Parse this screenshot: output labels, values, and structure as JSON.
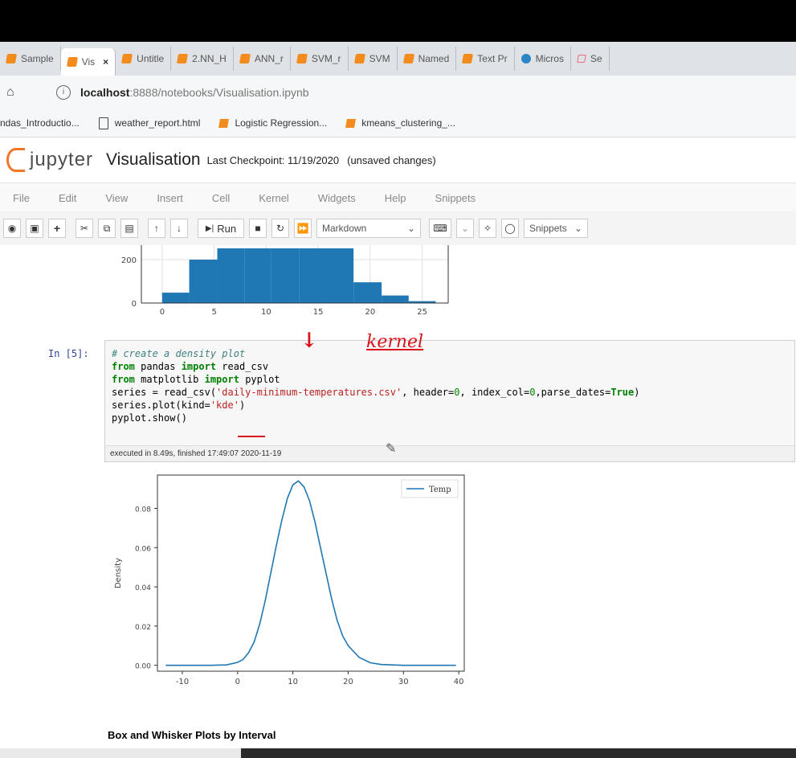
{
  "browser": {
    "tabs": [
      {
        "label": "Sample",
        "icon": "jupyter-favicon-icon"
      },
      {
        "label": "Vis",
        "icon": "jupyter-favicon-icon",
        "active": true
      },
      {
        "label": "Untitle",
        "icon": "jupyter-favicon-icon"
      },
      {
        "label": "2.NN_H",
        "icon": "jupyter-favicon-icon"
      },
      {
        "label": "ANN_r",
        "icon": "jupyter-favicon-icon"
      },
      {
        "label": "SVM_r",
        "icon": "jupyter-favicon-icon"
      },
      {
        "label": "SVM",
        "icon": "jupyter-favicon-icon"
      },
      {
        "label": "Named",
        "icon": "jupyter-favicon-icon"
      },
      {
        "label": "Text Pr",
        "icon": "jupyter-favicon-icon"
      },
      {
        "label": "Micros",
        "icon": "edge-favicon-icon"
      },
      {
        "label": "Se",
        "icon": "page-favicon-icon"
      }
    ],
    "tab_close": "×",
    "url_host": "localhost",
    "url_rest": ":8888/notebooks/Visualisation.ipynb",
    "bookmarks": [
      {
        "label": "ndas_Introductio...",
        "icon": "none"
      },
      {
        "label": "weather_report.html",
        "icon": "document-icon"
      },
      {
        "label": "Logistic Regression...",
        "icon": "jupyter-favicon-icon"
      },
      {
        "label": "kmeans_clustering_...",
        "icon": "jupyter-favicon-icon"
      }
    ]
  },
  "jupyter": {
    "logo_text": "jupyter",
    "notebook_title": "Visualisation",
    "checkpoint": "Last Checkpoint: 11/19/2020",
    "unsaved": "(unsaved changes)",
    "menu": [
      "File",
      "Edit",
      "View",
      "Insert",
      "Cell",
      "Kernel",
      "Widgets",
      "Help",
      "Snippets"
    ],
    "toolbar": {
      "run_label": "Run",
      "cell_type": "Markdown",
      "snippets": "Snippets"
    }
  },
  "cell": {
    "prompt": "In [5]:",
    "code": {
      "line1": "# create a density plot",
      "line2_kw1": "from",
      "line2_mod": " pandas ",
      "line2_kw2": "import",
      "line2_rest": " read_csv",
      "line3_kw1": "from",
      "line3_mod": " matplotlib ",
      "line3_kw2": "import",
      "line3_rest": " pyplot",
      "line4_a": "series = read_csv(",
      "line4_str": "'daily-minimum-temperatures.csv'",
      "line4_b": ", header=",
      "line4_n1": "0",
      "line4_c": ", index_col=",
      "line4_n2": "0",
      "line4_d": ",parse_dates=",
      "line4_t": "True",
      "line4_e": ")",
      "line5_a": "series.plot(kind=",
      "line5_str": "'kde'",
      "line5_b": ")",
      "line6": "pyplot.show()"
    },
    "exec_info": "executed in 8.49s, finished 17:49:07 2020-11-19"
  },
  "annotations": {
    "kernel_note": "kernel",
    "arrow1": "↓",
    "arrow2": "↓"
  },
  "markdown_heading": "Box and Whisker Plots by Interval",
  "chart_data": [
    {
      "type": "bar",
      "title": "",
      "x_ticks": [
        "0",
        "5",
        "10",
        "15",
        "20",
        "25"
      ],
      "y_ticks": [
        "0",
        "200"
      ],
      "bins": [
        0,
        2.6,
        5.3,
        7.9,
        10.5,
        13.2,
        15.8,
        18.4,
        21.1,
        23.7,
        26.3
      ],
      "values": [
        55,
        230,
        290,
        290,
        290,
        290,
        290,
        110,
        40,
        10
      ],
      "xlim": [
        -2,
        27.5
      ],
      "ylim": [
        0,
        260
      ],
      "color": "#1f77b4",
      "grid": true
    },
    {
      "type": "line",
      "title": "",
      "xlabel": "",
      "ylabel": "Density",
      "series": [
        {
          "name": "Temp",
          "color": "#1f77b4"
        }
      ],
      "x": [
        -13,
        -10,
        -5,
        -2,
        0,
        1,
        2,
        3,
        4,
        5,
        6,
        7,
        8,
        9,
        10,
        11,
        12,
        13,
        14,
        15,
        16,
        17,
        18,
        19,
        20,
        22,
        24,
        26,
        30,
        35,
        39.5
      ],
      "y": [
        0.0,
        0.0,
        0.0,
        0.0002,
        0.0015,
        0.003,
        0.0065,
        0.012,
        0.021,
        0.033,
        0.047,
        0.061,
        0.074,
        0.085,
        0.092,
        0.094,
        0.091,
        0.084,
        0.073,
        0.06,
        0.047,
        0.034,
        0.023,
        0.015,
        0.01,
        0.004,
        0.0013,
        0.0004,
        0.0,
        0.0,
        0.0
      ],
      "x_ticks": [
        "-10",
        "0",
        "10",
        "20",
        "30",
        "40"
      ],
      "y_ticks": [
        "0.00",
        "0.02",
        "0.04",
        "0.06",
        "0.08"
      ],
      "xlim": [
        -14.5,
        41
      ],
      "ylim": [
        -0.003,
        0.097
      ],
      "legend": "top-right",
      "grid": false
    }
  ]
}
